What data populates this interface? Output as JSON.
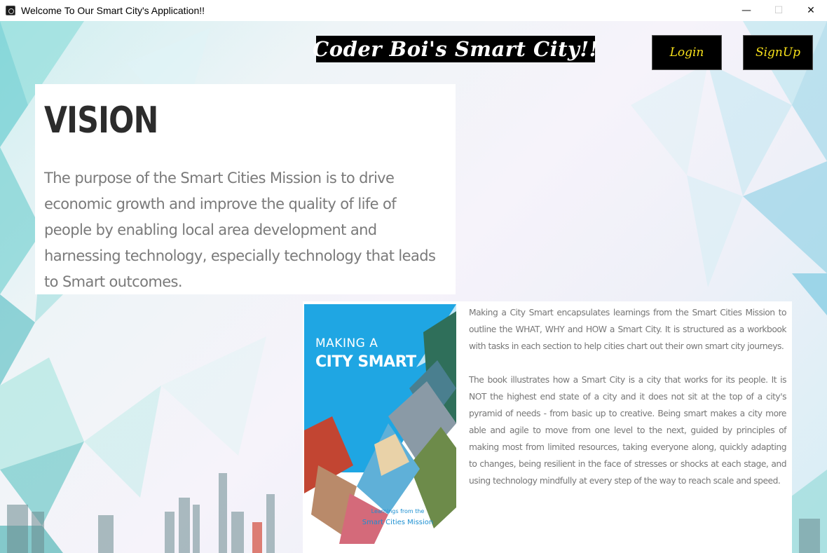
{
  "window": {
    "title": "Welcome To Our Smart City's Application!!",
    "controls": {
      "minimize": "—",
      "maximize": "☐",
      "close": "✕"
    }
  },
  "header": {
    "brand": "Coder Boi's Smart City!!",
    "login_label": "Login",
    "signup_label": "SignUp"
  },
  "vision": {
    "title": "VISION",
    "text": "The purpose of the Smart Cities Mission is to drive economic growth and improve the quality of life of people by enabling local area development and harnessing technology, especially technology that leads to Smart outcomes."
  },
  "book": {
    "cover_line1": "MAKING A",
    "cover_line2": "CITY SMART",
    "cover_sub1": "Learnings from the",
    "cover_sub2": "Smart Cities Mission",
    "paragraph1": "Making a City Smart encapsulates learnings from the Smart Cities Mission to outline the WHAT, WHY and HOW a Smart City. It is structured as a workbook with tasks in each section to help cities chart out their own smart city journeys.",
    "paragraph2": "The book illustrates how a Smart City is a city that works for its people. It is NOT the highest end state of a city and it does not sit at the top of a city's pyramid of needs - from basic up to creative. Being smart makes a city more able and agile to move from one level to the next, guided by principles of making most from limited resources, taking everyone along, quickly adapting to changes, being resilient in the face of stresses or shocks at each stage, and using technology mindfully at every step of the way to reach scale and speed."
  },
  "colors": {
    "button_bg": "#000000",
    "button_text": "#f7e11a",
    "cover_blue": "#1fa6e3"
  }
}
